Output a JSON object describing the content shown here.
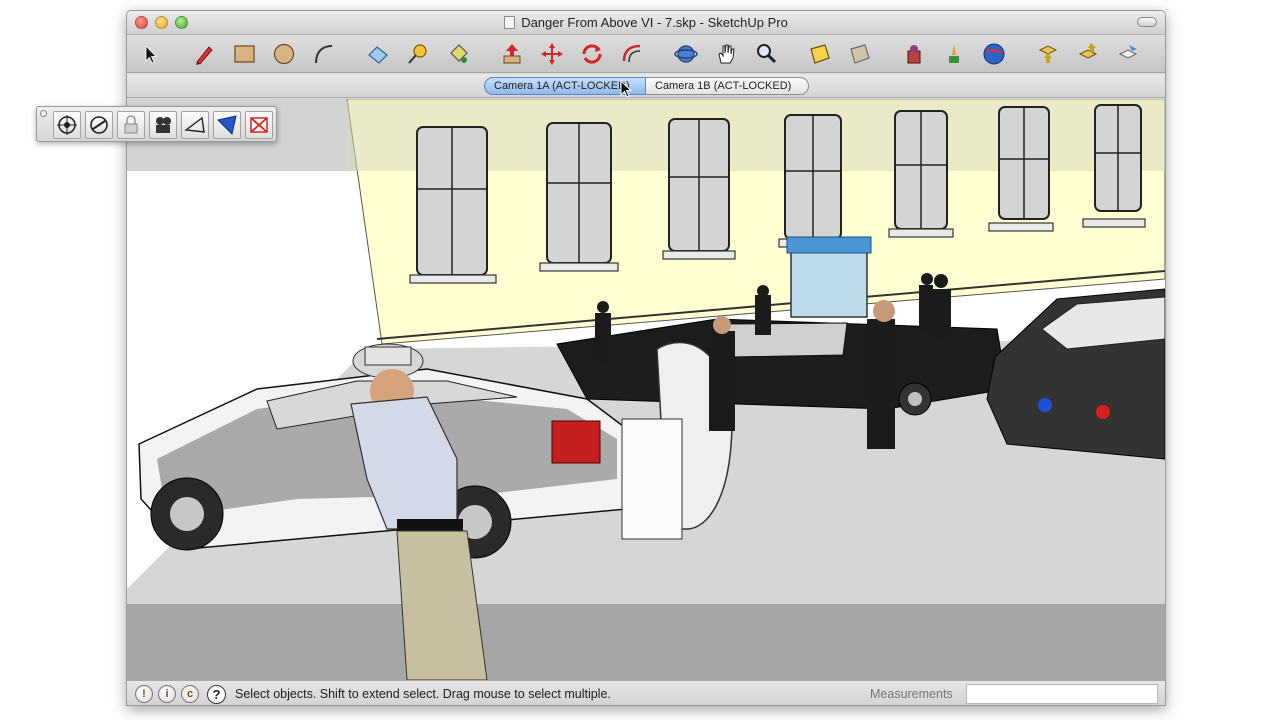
{
  "window": {
    "title": "Danger From Above VI - 7.skp - SketchUp Pro"
  },
  "toolbar": {
    "tools": [
      "select-icon",
      "pencil-icon",
      "rectangle-icon",
      "circle-icon",
      "arc-icon",
      "eraser-icon",
      "tape-measure-icon",
      "paint-bucket-icon",
      "push-pull-icon",
      "move-icon",
      "rotate-icon",
      "offset-icon",
      "orbit-icon",
      "pan-icon",
      "zoom-icon",
      "section-plane-icon",
      "section-plane-alt-icon",
      "component-icon",
      "get-models-icon",
      "google-earth-icon",
      "import-icon",
      "export-icon",
      "share-icon"
    ]
  },
  "scenes": {
    "tabs": [
      {
        "label": "Camera 1A (ACT-LOCKED)",
        "active": true
      },
      {
        "label": "Camera 1B (ACT-LOCKED)",
        "active": false
      }
    ]
  },
  "camera_palette": {
    "buttons": [
      "look-through-camera-icon",
      "camera-properties-icon",
      "lock-camera-icon",
      "film-camera-icon",
      "frustum-icon",
      "frustum-fill-icon",
      "delete-camera-icon"
    ]
  },
  "status": {
    "text": "Select objects. Shift to extend select. Drag mouse to select multiple.",
    "measurements_label": "Measurements",
    "measurements_value": "",
    "help_icon": "?"
  },
  "colors": {
    "accent_tab": "#8fb9ee",
    "building": "#ffffd2",
    "ground": "#d6d6d6"
  }
}
